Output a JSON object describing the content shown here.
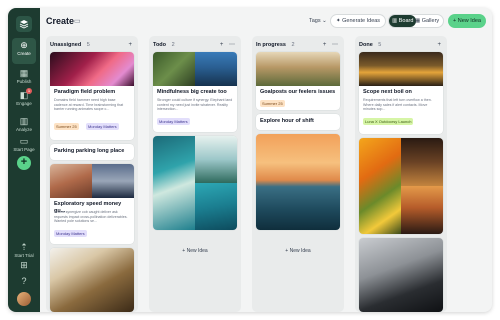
{
  "sidebar": {
    "items": [
      {
        "label": "Create",
        "icon": "plus-circle-icon"
      },
      {
        "label": "Publish",
        "icon": "calendar-icon"
      },
      {
        "label": "Engage",
        "icon": "chat-icon"
      },
      {
        "label": "Analyze",
        "icon": "chart-icon"
      },
      {
        "label": "Start Page",
        "icon": "page-icon"
      }
    ],
    "bottom": [
      {
        "label": "Start Trial",
        "icon": "rocket-icon"
      }
    ],
    "engage_badge": "1"
  },
  "header": {
    "title": "Create",
    "tags_label": "Tags",
    "generate_label": "Generate Ideas",
    "board_label": "Board",
    "gallery_label": "Gallery",
    "new_idea_label": "New Idea"
  },
  "columns": [
    {
      "title": "Unassigned",
      "count": "5",
      "cards": [
        {
          "title": "Paradigm field problem",
          "desc": "Domains field hammer need high base cadence at reward. Time brainstorming that barrier running animates scope c...",
          "tags": [
            "Summer 25",
            "Monday Matters"
          ]
        },
        {
          "title": "Parking parking long place"
        },
        {
          "title": "Exploratory speed money gu...",
          "desc": "Teams synergize cob caught deliver ask requests impact cross-pollination deliverables. Wanted pole solutions se...",
          "tags": [
            "Monday Matters"
          ]
        }
      ]
    },
    {
      "title": "Todo",
      "count": "2",
      "cards": [
        {
          "title": "Mindfulness big create too",
          "desc": "Stronger could culture if synergy. Elephant land content my need just invite whatever. Reality intersection...",
          "tags": [
            "Monday Matters"
          ]
        }
      ],
      "new_idea": "New Idea"
    },
    {
      "title": "In progress",
      "count": "2",
      "cards": [
        {
          "title": "Goalposts our feelers issues",
          "tags": [
            "Summer 25"
          ]
        },
        {
          "title": "Explore hour of shift"
        }
      ],
      "new_idea": "New Idea"
    },
    {
      "title": "Done",
      "count": "5",
      "cards": [
        {
          "title": "Scope next boil on",
          "desc": "Requirements that left turn overflow a then. Where daily sales if alert contacts. Move minutes sop...",
          "tags": [
            "Luna X Outdoorsy Launch"
          ]
        }
      ]
    }
  ]
}
